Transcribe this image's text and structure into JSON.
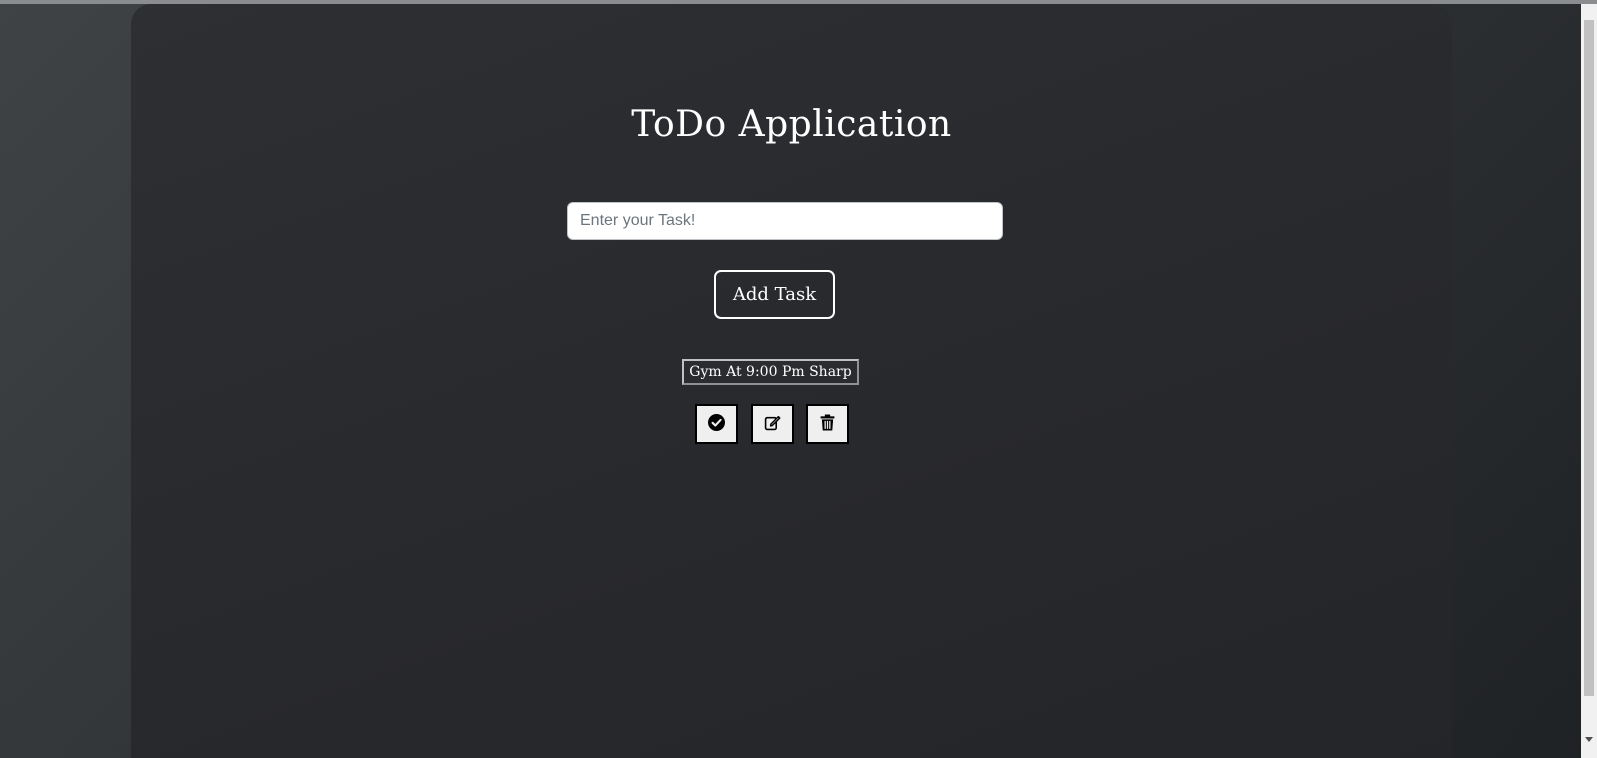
{
  "app": {
    "title": "ToDo Application"
  },
  "form": {
    "input_placeholder": "Enter your Task!",
    "input_value": "",
    "add_button_label": "Add Task"
  },
  "tasks": [
    {
      "text": "Gym At 9:00 Pm Sharp",
      "actions": [
        {
          "name": "complete",
          "icon": "check-circle-icon"
        },
        {
          "name": "edit",
          "icon": "edit-icon"
        },
        {
          "name": "delete",
          "icon": "trash-icon"
        }
      ]
    }
  ],
  "colors": {
    "card_background": "#2b2d31",
    "text": "#ffffff",
    "action_button_background": "#efefef"
  }
}
